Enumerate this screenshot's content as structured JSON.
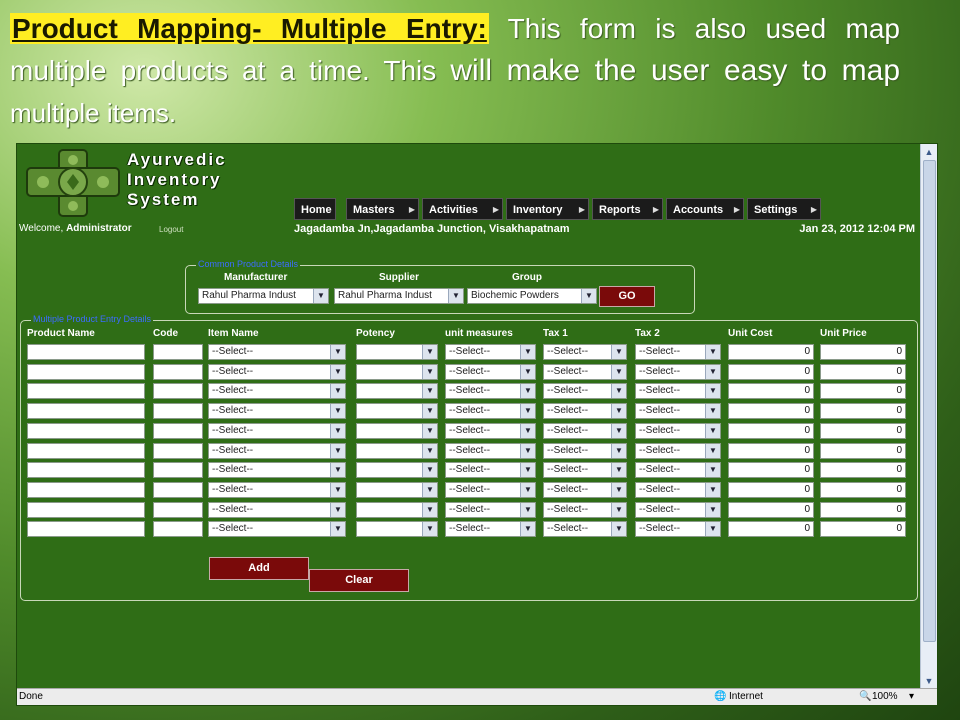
{
  "slide": {
    "heading": "Product Mapping- Multiple Entry:",
    "text1": " This form is also used map multiple products at a time. This ",
    "text2": "will make the user easy to map",
    "text3": " multiple items."
  },
  "app": {
    "brand_line1": "Ayurvedic",
    "brand_line2": "Inventory",
    "brand_line3": "System",
    "nav": [
      "Home",
      "Masters",
      "Activities",
      "Inventory",
      "Reports",
      "Accounts",
      "Settings"
    ],
    "welcome_prefix": "Welcome, ",
    "user": "Administrator",
    "logout": "Logout",
    "location": "Jagadamba Jn,Jagadamba Junction, Visakhapatnam",
    "datetime": "Jan 23, 2012 12:04 PM"
  },
  "common": {
    "legend": "Common Product Details",
    "manufacturer_label": "Manufacturer",
    "supplier_label": "Supplier",
    "group_label": "Group",
    "manufacturer_value": "Rahul Pharma Indust",
    "supplier_value": "Rahul Pharma Indust",
    "group_value": "Biochemic Powders",
    "go_label": "GO"
  },
  "entry": {
    "legend": "Multiple Product Entry Details",
    "columns": [
      "Product Name",
      "Code",
      "Item Name",
      "Potency",
      "unit measures",
      "Tax 1",
      "Tax 2",
      "Unit Cost",
      "Unit Price"
    ],
    "select_placeholder": "--Select--",
    "default_number": "0",
    "row_count": 10,
    "add_label": "Add",
    "clear_label": "Clear"
  },
  "status": {
    "left": "Done",
    "zone": "Internet",
    "zoom": "100%"
  },
  "colors": {
    "page_bg": "#2f6d16",
    "legend": "#3c6cff",
    "button": "#7a0a0a",
    "nav": "#1b1b1b",
    "highlight": "#ffee22"
  }
}
